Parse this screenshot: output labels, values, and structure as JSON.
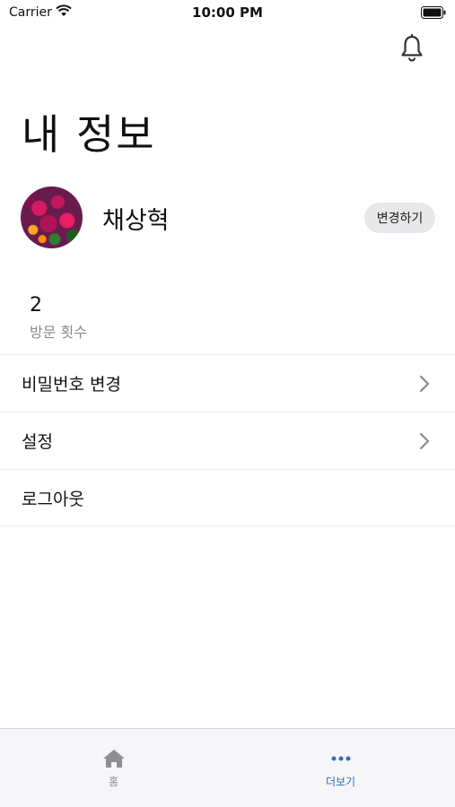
{
  "status_bar": {
    "carrier": "Carrier",
    "time": "10:00 PM"
  },
  "header": {
    "title": "내 정보",
    "notification_icon": "bell-icon"
  },
  "profile": {
    "name": "채상혁",
    "edit_label": "변경하기"
  },
  "stats": {
    "visit_count": "2",
    "visit_label": "방문 횟수"
  },
  "menu": {
    "items": [
      {
        "label": "비밀번호 변경",
        "has_chevron": true
      },
      {
        "label": "설정",
        "has_chevron": true
      },
      {
        "label": "로그아웃",
        "has_chevron": false
      }
    ]
  },
  "tab_bar": {
    "tabs": [
      {
        "label": "홈",
        "icon": "home-icon",
        "active": false
      },
      {
        "label": "더보기",
        "icon": "more-icon",
        "active": true
      }
    ],
    "active_color": "#2f6fb6",
    "inactive_color": "#8e8e93"
  }
}
